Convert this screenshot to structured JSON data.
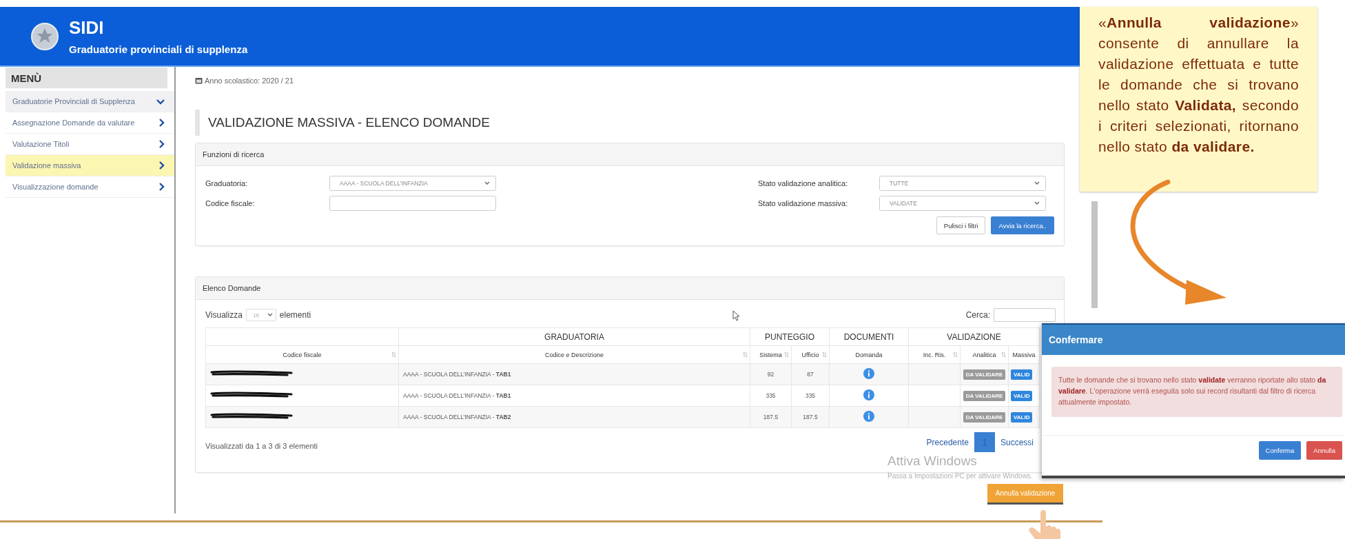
{
  "header": {
    "title": "SIDI",
    "subtitle": "Graduatorie provinciali di supplenza"
  },
  "sidebar": {
    "title": "MENÙ",
    "items": [
      {
        "label": "Graduatorie Provinciali di Supplenza",
        "expanded": true,
        "selected": false
      },
      {
        "label": "Assegnazione Domande da valutare",
        "expanded": false,
        "selected": false
      },
      {
        "label": "Valutazione Titoli",
        "expanded": false,
        "selected": false
      },
      {
        "label": "Validazione massiva",
        "expanded": false,
        "selected": true
      },
      {
        "label": "Visualizzazione domande",
        "expanded": false,
        "selected": false
      }
    ]
  },
  "school_year": "Anno scolastico: 2020 / 21",
  "page_title": "VALIDAZIONE MASSIVA - ELENCO DOMANDE",
  "search_panel": {
    "title": "Funzioni di ricerca",
    "fields": [
      {
        "label": "Graduatoria:",
        "kind": "select",
        "value": "AAAA - SCUOLA DELL'INFANZIA"
      },
      {
        "label": "Stato validazione analitica:",
        "kind": "select",
        "value": "TUTTE"
      },
      {
        "label": "Codice fiscale:",
        "kind": "text"
      },
      {
        "label": "Stato validazione massiva:",
        "kind": "select",
        "value": "VALIDATE"
      }
    ],
    "buttons": [
      {
        "label": "Pulisci i filtri",
        "kind": "default"
      },
      {
        "label": "Avvia la ricerca..",
        "kind": "primary"
      }
    ]
  },
  "results_panel": {
    "title": "Elenco Domande",
    "show_label": "Visualizza",
    "show_value": "10",
    "show_suffix": "elementi",
    "search_label": "Cerca:",
    "table": {
      "group_headers": [
        "GRADUATORIA",
        "PUNTEGGIO",
        "DOCUMENTI",
        "VALIDAZIONE"
      ],
      "columns": [
        {
          "label": "Codice fiscale",
          "sortable": true
        },
        {
          "label": "Codice e Descrizione",
          "sortable": true
        },
        {
          "label": "Sistema",
          "sortable": true
        },
        {
          "label": "Ufficio",
          "sortable": true
        },
        {
          "label": "Domanda",
          "sortable": false
        },
        {
          "label": "Inc. Ris.",
          "sortable": true
        },
        {
          "label": "Analitica",
          "sortable": true
        },
        {
          "label": "Massiva",
          "sortable": false
        }
      ],
      "rows": [
        {
          "redacted": true,
          "graduatoria": "AAAA - SCUOLA DELL'INFANZIA - **TAB1**",
          "sistema": "92",
          "ufficio": "87",
          "analitica": "DA VALIDARE",
          "massiva": "VALID"
        },
        {
          "redacted": true,
          "graduatoria": "AAAA - SCUOLA DELL'INFANZIA - **TAB1**",
          "sistema": "335",
          "ufficio": "335",
          "analitica": "DA VALIDARE",
          "massiva": "VALID"
        },
        {
          "redacted": true,
          "graduatoria": "AAAA - SCUOLA DELL'INFANZIA - **TAB2**",
          "sistema": "187.5",
          "ufficio": "187.5",
          "analitica": "DA VALIDARE",
          "massiva": "VALID"
        }
      ]
    },
    "info": "Visualizzati da 1 a 3 di 3 elementi",
    "pagination": [
      {
        "label": "Precedente",
        "selected": false
      },
      {
        "label": "1",
        "selected": true
      },
      {
        "label": "Successi",
        "selected": false
      }
    ]
  },
  "action_button": "Annulla validazione",
  "os_watermark": [
    "Attiva Windows",
    "Passa a Impostazioni PC per attivare Windows."
  ],
  "callout": "«**Annulla validazione**» consente di annullare la validazione effettuata e tutte le domande che si trovano nello stato **Validata,** secondo i criteri selezionati, ritornano nello stato **da validare.**",
  "dialog": {
    "title": "Confermare",
    "message": "Tutte le domande che si trovano nello stato **validate** verranno riportate allo stato **da validare**. L'operazione verrà eseguita solo sui record risultanti dal filtro di ricerca attualmente impostato.",
    "buttons": [
      {
        "label": "Conferma",
        "kind": "primary"
      },
      {
        "label": "Annulla",
        "kind": "danger"
      }
    ]
  }
}
